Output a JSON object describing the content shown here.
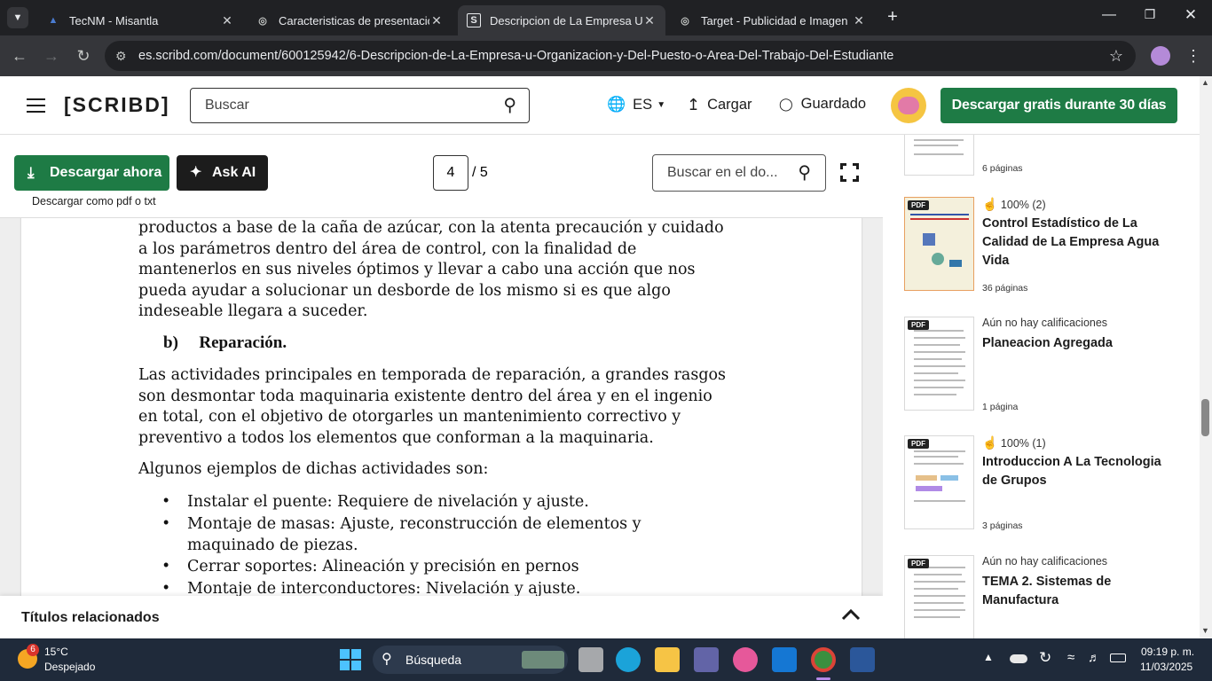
{
  "browser": {
    "tabs": [
      {
        "title": "TecNM - Misantla",
        "active": false
      },
      {
        "title": "Caracteristicas de presentacion",
        "active": false
      },
      {
        "title": "Descripcion de La Empresa U O",
        "active": true
      },
      {
        "title": "Target - Publicidad e Imagen",
        "active": false
      }
    ],
    "url": "es.scribd.com/document/600125942/6-Descripcion-de-La-Empresa-u-Organizacion-y-Del-Puesto-o-Area-Del-Trabajo-Del-Estudiante"
  },
  "header": {
    "logo": "[SCRIBD]",
    "search_placeholder": "Buscar",
    "language": "ES",
    "upload_label": "Cargar",
    "saved_label": "Guardado",
    "trial_label": "Descargar gratis durante 30 días"
  },
  "toolbar": {
    "download_now": "Descargar ahora",
    "ask_ai": "Ask AI",
    "download_as": "Descargar como pdf o txt",
    "current_page": "4",
    "total_pages": "/ 5",
    "doc_search_placeholder": "Buscar en el do..."
  },
  "document": {
    "para1": [
      "productos a base de la caña de azúcar, con la atenta precaución y cuidado",
      "a los parámetros dentro del área de control, con la finalidad de",
      "mantenerlos en sus niveles óptimos y llevar a cabo una acción que nos",
      "pueda ayudar a solucionar un desborde de los mismo si es que algo",
      "indeseable llegara a suceder."
    ],
    "heading_letter": "b)",
    "heading_text": "Reparación.",
    "para2": [
      "Las actividades principales en temporada de reparación, a grandes rasgos",
      "son desmontar toda maquinaria existente dentro del área y en el ingenio",
      "en total, con el objetivo de otorgarles un mantenimiento correctivo y",
      "preventivo a todos los elementos que conforman a la maquinaria."
    ],
    "para3": "Algunos ejemplos de dichas actividades son:",
    "bullets": [
      [
        "Instalar el puente: Requiere de nivelación y ajuste."
      ],
      [
        "Montaje de masas: Ajuste, reconstrucción de elementos y",
        "maquinado de piezas."
      ],
      [
        "Cerrar soportes: Alineación y precisión en pernos"
      ],
      [
        "Montaje de interconductores: Nivelación y ajuste."
      ]
    ]
  },
  "related": {
    "title": "Títulos relacionados"
  },
  "sidebar": {
    "partial_card_pages": "6 páginas",
    "cards": [
      {
        "badge": "PDF",
        "rating": "100% (2)",
        "title": "Control Estadístico de La Calidad de La Empresa Agua Vida",
        "pages": "36 páginas"
      },
      {
        "badge": "PDF",
        "rating": "Aún no hay calificaciones",
        "title": "Planeacion Agregada",
        "pages": "1 página"
      },
      {
        "badge": "PDF",
        "rating": "100% (1)",
        "title": "Introduccion A La Tecnologia de Grupos",
        "pages": "3 páginas"
      },
      {
        "badge": "PDF",
        "rating": "Aún no hay calificaciones",
        "title": "TEMA 2. Sistemas de Manufactura",
        "pages": ""
      }
    ]
  },
  "taskbar": {
    "weather_temp": "15°C",
    "weather_desc": "Despejado",
    "weather_badge": "6",
    "search_label": "Búsqueda",
    "time": "09:19 p. m.",
    "date": "11/03/2025"
  },
  "colors": {
    "brand_green": "#1e7b45",
    "chrome_dark": "#202124",
    "taskbar": "#1f2a3a"
  }
}
